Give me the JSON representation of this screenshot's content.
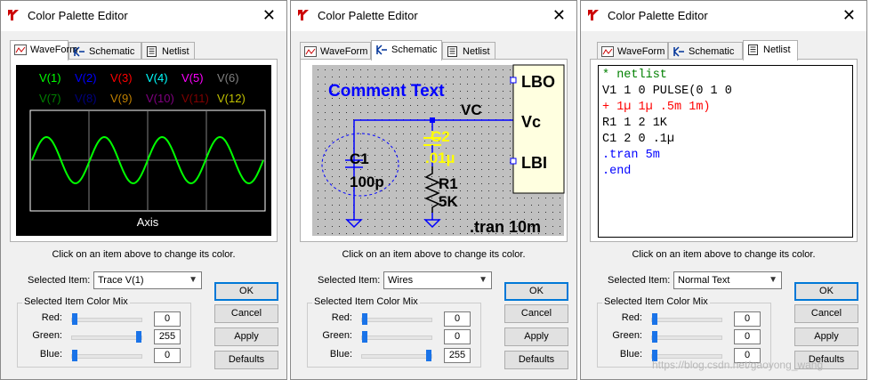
{
  "dialogs": [
    {
      "title": "Color Palette Editor",
      "tabs": [
        "WaveForm",
        "Schematic",
        "Netlist"
      ],
      "active_tab": 0,
      "hint": "Click on an item above to change its color.",
      "selected_item_label": "Selected Item:",
      "selected_item": "Trace  V(1)",
      "mix_title": "Selected Item Color Mix",
      "channels": [
        {
          "label": "Red:",
          "value": "0",
          "level": 0
        },
        {
          "label": "Green:",
          "value": "255",
          "level": 1
        },
        {
          "label": "Blue:",
          "value": "0",
          "level": 0
        }
      ],
      "buttons": [
        "OK",
        "Cancel",
        "Apply",
        "Defaults"
      ]
    },
    {
      "title": "Color Palette Editor",
      "tabs": [
        "WaveForm",
        "Schematic",
        "Netlist"
      ],
      "active_tab": 1,
      "hint": "Click on an item above to change its color.",
      "selected_item_label": "Selected Item:",
      "selected_item": "Wires",
      "mix_title": "Selected Item Color Mix",
      "channels": [
        {
          "label": "Red:",
          "value": "0",
          "level": 0
        },
        {
          "label": "Green:",
          "value": "0",
          "level": 0
        },
        {
          "label": "Blue:",
          "value": "255",
          "level": 1
        }
      ],
      "buttons": [
        "OK",
        "Cancel",
        "Apply",
        "Defaults"
      ]
    },
    {
      "title": "Color Palette Editor",
      "tabs": [
        "WaveForm",
        "Schematic",
        "Netlist"
      ],
      "active_tab": 2,
      "hint": "Click on an item above to change its color.",
      "selected_item_label": "Selected Item:",
      "selected_item": "Normal Text",
      "mix_title": "Selected Item Color Mix",
      "channels": [
        {
          "label": "Red:",
          "value": "0",
          "level": 0
        },
        {
          "label": "Green:",
          "value": "0",
          "level": 0
        },
        {
          "label": "Blue:",
          "value": "0",
          "level": 0
        }
      ],
      "buttons": [
        "OK",
        "Cancel",
        "Apply",
        "Defaults"
      ]
    }
  ],
  "waveform": {
    "traces": [
      {
        "label": "V(1)",
        "color": "#00ff00"
      },
      {
        "label": "V(2)",
        "color": "#0000ff"
      },
      {
        "label": "V(3)",
        "color": "#ff0000"
      },
      {
        "label": "V(4)",
        "color": "#00ffff"
      },
      {
        "label": "V(5)",
        "color": "#ff00ff"
      },
      {
        "label": "V(6)",
        "color": "#808080"
      },
      {
        "label": "V(7)",
        "color": "#008000"
      },
      {
        "label": "V(8)",
        "color": "#000080"
      },
      {
        "label": "V(9)",
        "color": "#c08000"
      },
      {
        "label": "V(10)",
        "color": "#800080"
      },
      {
        "label": "V(11)",
        "color": "#800000"
      },
      {
        "label": "V(12)",
        "color": "#c0c000"
      }
    ],
    "axis_label": "Axis",
    "background": "#000000",
    "sine_color": "#00ff00"
  },
  "schematic": {
    "comment_text": "Comment Text",
    "net_label": "VC",
    "port_labels": [
      "LBO",
      "Vc",
      "LBI"
    ],
    "c1_name": "C1",
    "c1_value": "100p",
    "c2_name": "C2",
    "c2_value": ".01µ",
    "r1_name": "R1",
    "r1_value": "5K",
    "directive": ".tran 10m",
    "wire_color": "#0000ff",
    "background": "#c0c0c0",
    "selected_color": "#ffff00"
  },
  "netlist": {
    "lines": [
      {
        "text": "* netlist",
        "color": "#008000"
      },
      {
        "text": "V1 1 0 PULSE(0 1 0",
        "color": "#000000"
      },
      {
        "text": "+ 1µ 1µ .5m 1m)",
        "color": "#ff0000"
      },
      {
        "text": "R1 1 2 1K",
        "color": "#000000"
      },
      {
        "text": "C1 2 0 .1µ",
        "color": "#000000"
      },
      {
        "text": ".tran 5m",
        "color": "#0000ff"
      },
      {
        "text": ".end",
        "color": "#0000ff"
      }
    ]
  },
  "watermark": "https://blog.csdn.net/gaoyong_wang"
}
